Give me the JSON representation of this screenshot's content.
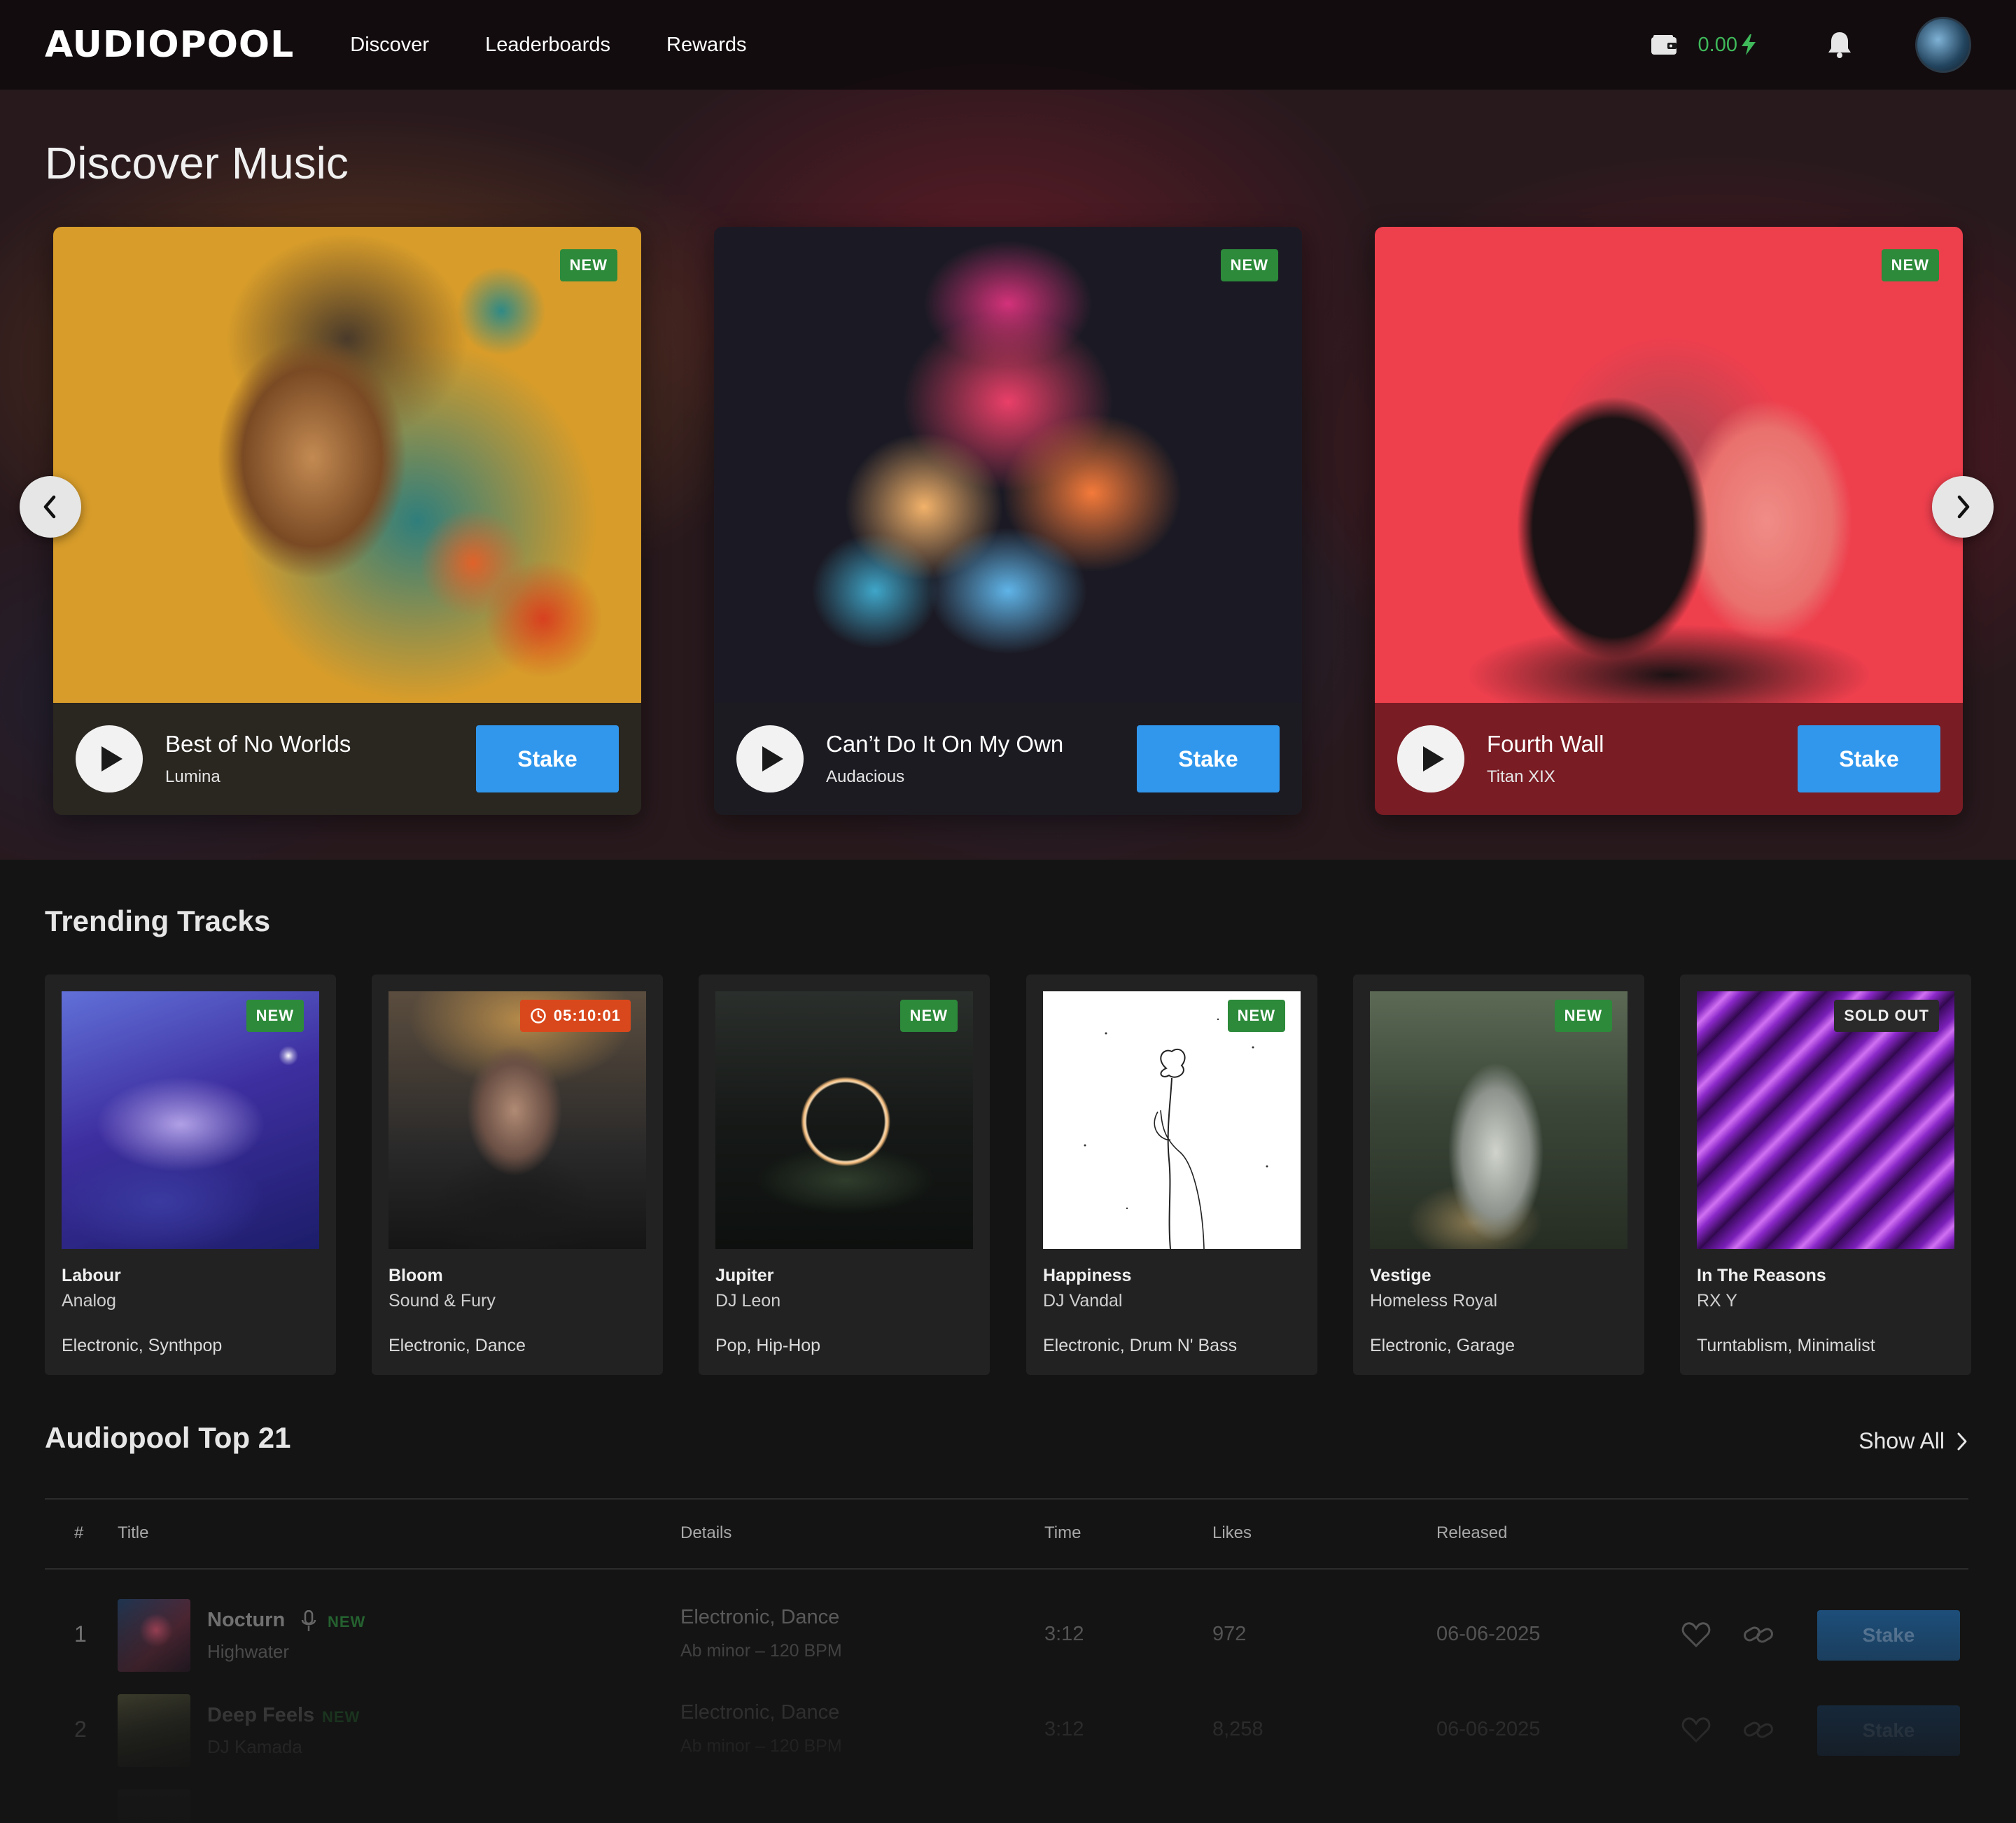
{
  "header": {
    "logo": "AUDIOPOOL",
    "nav": [
      "Discover",
      "Leaderboards",
      "Rewards"
    ],
    "balance": "0.00",
    "icons": [
      "wallet-icon",
      "bolt-icon",
      "bell-icon"
    ]
  },
  "discover": {
    "title": "Discover Music",
    "cards": [
      {
        "badge": "NEW",
        "title": "Best of No Worlds",
        "artist": "Lumina",
        "stake": "Stake",
        "bar_color": "#2a2620"
      },
      {
        "badge": "NEW",
        "title": "Can’t Do It On My Own",
        "artist": "Audacious",
        "stake": "Stake",
        "bar_color": "#1d1b22"
      },
      {
        "badge": "NEW",
        "title": "Fourth Wall",
        "artist": "Titan XIX",
        "stake": "Stake",
        "bar_color": "#7a1c24"
      }
    ]
  },
  "trending": {
    "title": "Trending Tracks",
    "cards": [
      {
        "badge": "NEW",
        "title": "Labour",
        "artist": "Analog",
        "genres": "Electronic, Synthpop"
      },
      {
        "badge": "05:10:01",
        "title": "Bloom",
        "artist": "Sound & Fury",
        "genres": "Electronic, Dance"
      },
      {
        "badge": "NEW",
        "title": "Jupiter",
        "artist": "DJ Leon",
        "genres": "Pop, Hip-Hop"
      },
      {
        "badge": "NEW",
        "title": "Happiness",
        "artist": "DJ Vandal",
        "genres": "Electronic, Drum N' Bass"
      },
      {
        "badge": "NEW",
        "title": "Vestige",
        "artist": "Homeless Royal",
        "genres": "Electronic, Garage"
      },
      {
        "badge": "SOLD OUT",
        "title": "In The Reasons",
        "artist": "RX Y",
        "genres": "Turntablism, Minimalist"
      }
    ]
  },
  "top21": {
    "title": "Audiopool Top 21",
    "show_all": "Show All",
    "columns": {
      "num": "#",
      "title": "Title",
      "details": "Details",
      "time": "Time",
      "likes": "Likes",
      "released": "Released"
    },
    "rows": [
      {
        "rank": "1",
        "title": "Nocturn",
        "badge": "NEW",
        "artist": "Highwater",
        "genres": "Electronic, Dance",
        "key": "Ab minor – 120 BPM",
        "time": "3:12",
        "likes": "972",
        "released": "06-06-2025",
        "stake": "Stake"
      },
      {
        "rank": "2",
        "title": "Deep Feels",
        "badge": "NEW",
        "artist": "DJ Kamada",
        "genres": "Electronic, Dance",
        "key": "Ab minor – 120 BPM",
        "time": "3:12",
        "likes": "8,258",
        "released": "06-06-2025",
        "stake": "Stake"
      }
    ]
  },
  "colors": {
    "accent": "#3197ec",
    "new_badge": "#2c8a3a",
    "timer_badge": "#d9481c",
    "balance": "#3fb95a"
  }
}
